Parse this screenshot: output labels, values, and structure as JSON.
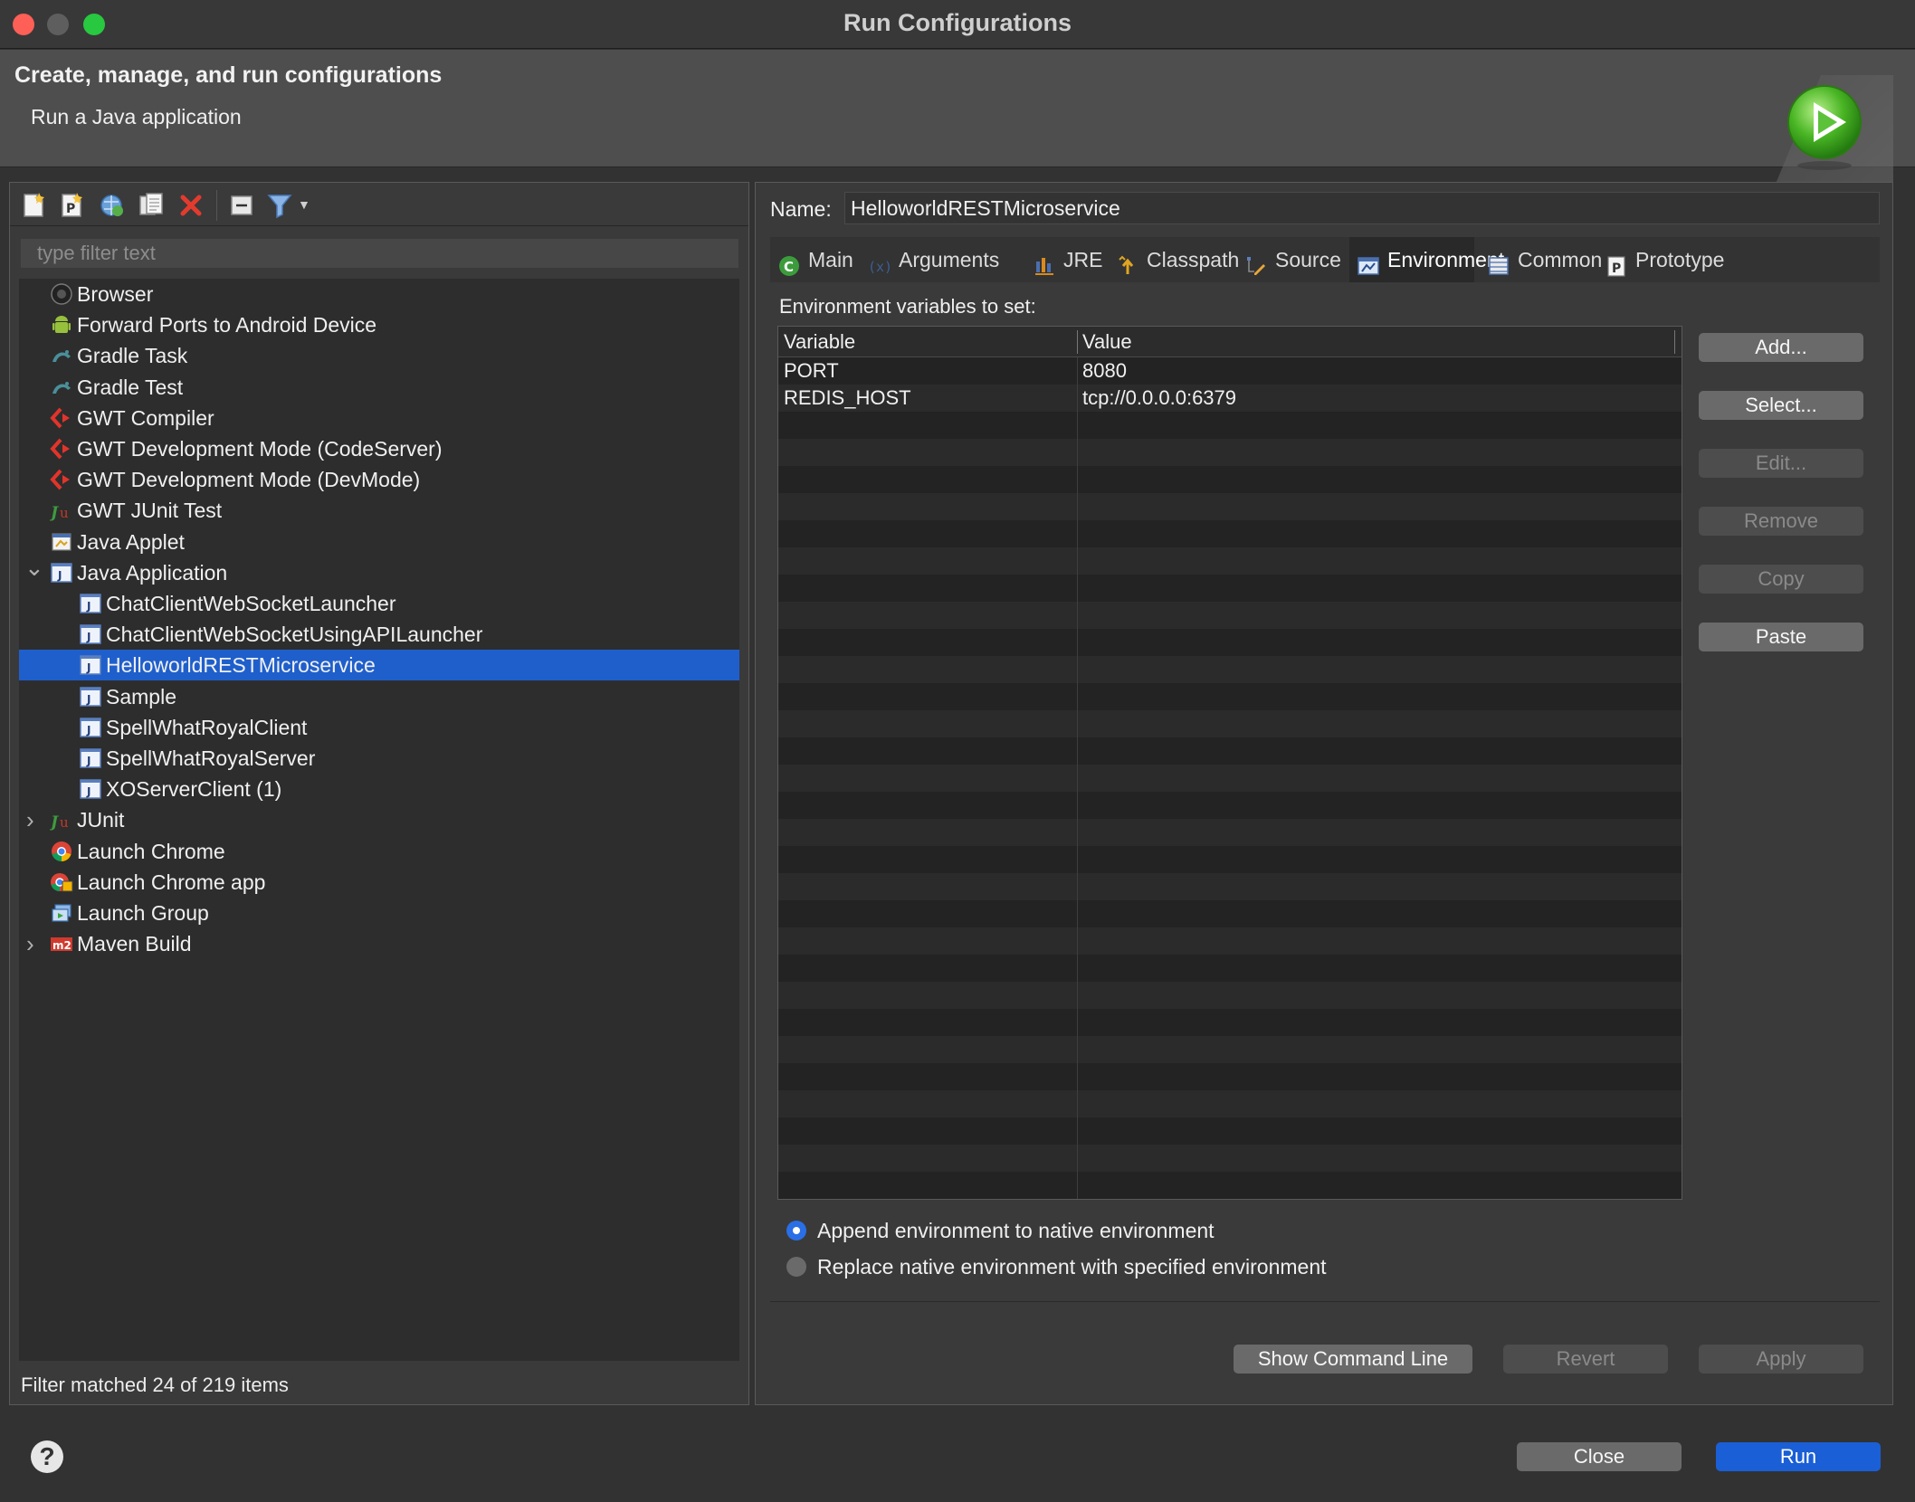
{
  "window": {
    "title": "Run Configurations"
  },
  "header": {
    "title": "Create, manage, and run configurations",
    "subtitle": "Run a Java application"
  },
  "left": {
    "toolbar": [
      {
        "name": "new-configuration-icon"
      },
      {
        "name": "new-prototype-icon"
      },
      {
        "name": "export-configuration-icon"
      },
      {
        "name": "duplicate-icon"
      },
      {
        "name": "delete-icon"
      },
      {
        "name": "collapse-all-icon"
      },
      {
        "name": "filter-icon"
      }
    ],
    "filter_placeholder": "type filter text",
    "tree": [
      {
        "label": "Browser",
        "icon": "browser-icon",
        "level": 0,
        "selected": false,
        "twisty": ""
      },
      {
        "label": "Forward Ports to Android Device",
        "icon": "android-icon",
        "level": 0,
        "selected": false,
        "twisty": ""
      },
      {
        "label": "Gradle Task",
        "icon": "gradle-icon",
        "level": 0,
        "selected": false,
        "twisty": ""
      },
      {
        "label": "Gradle Test",
        "icon": "gradle-icon",
        "level": 0,
        "selected": false,
        "twisty": ""
      },
      {
        "label": "GWT Compiler",
        "icon": "gwt-icon",
        "level": 0,
        "selected": false,
        "twisty": ""
      },
      {
        "label": "GWT Development Mode (CodeServer)",
        "icon": "gwt-icon",
        "level": 0,
        "selected": false,
        "twisty": ""
      },
      {
        "label": "GWT Development Mode (DevMode)",
        "icon": "gwt-icon",
        "level": 0,
        "selected": false,
        "twisty": ""
      },
      {
        "label": "GWT JUnit Test",
        "icon": "junit-icon",
        "level": 0,
        "selected": false,
        "twisty": ""
      },
      {
        "label": "Java Applet",
        "icon": "applet-icon",
        "level": 0,
        "selected": false,
        "twisty": ""
      },
      {
        "label": "Java Application",
        "icon": "java-app-icon",
        "level": 0,
        "selected": false,
        "twisty": "expanded"
      },
      {
        "label": "ChatClientWebSocketLauncher",
        "icon": "java-app-icon",
        "level": 1,
        "selected": false,
        "twisty": ""
      },
      {
        "label": "ChatClientWebSocketUsingAPILauncher",
        "icon": "java-app-icon",
        "level": 1,
        "selected": false,
        "twisty": ""
      },
      {
        "label": "HelloworldRESTMicroservice",
        "icon": "java-app-icon",
        "level": 1,
        "selected": true,
        "twisty": ""
      },
      {
        "label": "Sample",
        "icon": "java-app-icon",
        "level": 1,
        "selected": false,
        "twisty": ""
      },
      {
        "label": "SpellWhatRoyalClient",
        "icon": "java-app-icon",
        "level": 1,
        "selected": false,
        "twisty": ""
      },
      {
        "label": "SpellWhatRoyalServer",
        "icon": "java-app-icon",
        "level": 1,
        "selected": false,
        "twisty": ""
      },
      {
        "label": "XOServerClient (1)",
        "icon": "java-app-icon",
        "level": 1,
        "selected": false,
        "twisty": ""
      },
      {
        "label": "JUnit",
        "icon": "junit-icon",
        "level": 0,
        "selected": false,
        "twisty": "collapsed"
      },
      {
        "label": "Launch Chrome",
        "icon": "chrome-icon",
        "level": 0,
        "selected": false,
        "twisty": ""
      },
      {
        "label": "Launch Chrome app",
        "icon": "chrome-app-icon",
        "level": 0,
        "selected": false,
        "twisty": ""
      },
      {
        "label": "Launch Group",
        "icon": "launch-group-icon",
        "level": 0,
        "selected": false,
        "twisty": ""
      },
      {
        "label": "Maven Build",
        "icon": "maven-icon",
        "level": 0,
        "selected": false,
        "twisty": "collapsed"
      }
    ],
    "filter_status": "Filter matched 24 of 219 items"
  },
  "right": {
    "name_label": "Name:",
    "name_value": "HelloworldRESTMicroservice",
    "tabs": [
      {
        "label": "Main",
        "icon": "main-tab-icon",
        "active": false
      },
      {
        "label": "Arguments",
        "icon": "arguments-tab-icon",
        "active": false
      },
      {
        "label": "JRE",
        "icon": "jre-tab-icon",
        "active": false
      },
      {
        "label": "Classpath",
        "icon": "classpath-tab-icon",
        "active": false
      },
      {
        "label": "Source",
        "icon": "source-tab-icon",
        "active": false
      },
      {
        "label": "Environment",
        "icon": "environment-tab-icon",
        "active": true
      },
      {
        "label": "Common",
        "icon": "common-tab-icon",
        "active": false
      },
      {
        "label": "Prototype",
        "icon": "prototype-tab-icon",
        "active": false
      }
    ],
    "env_label": "Environment variables to set:",
    "table": {
      "columns": [
        "Variable",
        "Value"
      ],
      "rows": [
        {
          "variable": "PORT",
          "value": "8080"
        },
        {
          "variable": "REDIS_HOST",
          "value": "tcp://0.0.0.0:6379"
        }
      ]
    },
    "side_buttons": [
      {
        "label": "Add...",
        "enabled": true
      },
      {
        "label": "Select...",
        "enabled": true
      },
      {
        "label": "Edit...",
        "enabled": false
      },
      {
        "label": "Remove",
        "enabled": false
      },
      {
        "label": "Copy",
        "enabled": false
      },
      {
        "label": "Paste",
        "enabled": true
      }
    ],
    "radios": [
      {
        "label": "Append environment to native environment",
        "checked": true
      },
      {
        "label": "Replace native environment with specified environment",
        "checked": false
      }
    ],
    "bottom_buttons": [
      {
        "label": "Show Command Line",
        "enabled": true
      },
      {
        "label": "Revert",
        "enabled": false
      },
      {
        "label": "Apply",
        "enabled": false
      }
    ]
  },
  "footer": {
    "help": "?",
    "close_label": "Close",
    "run_label": "Run"
  }
}
